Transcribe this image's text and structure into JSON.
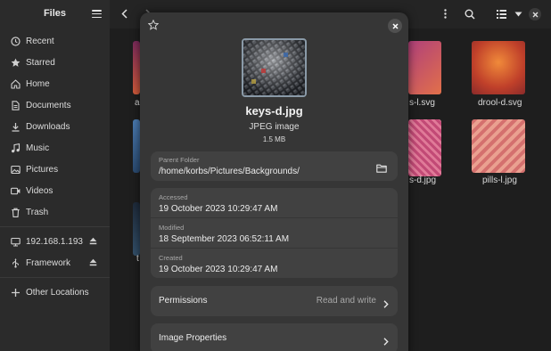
{
  "sidebar": {
    "title": "Files",
    "items": [
      {
        "label": "Recent",
        "icon": "clock-icon"
      },
      {
        "label": "Starred",
        "icon": "star-icon"
      },
      {
        "label": "Home",
        "icon": "home-icon"
      },
      {
        "label": "Documents",
        "icon": "document-icon"
      },
      {
        "label": "Downloads",
        "icon": "download-icon"
      },
      {
        "label": "Music",
        "icon": "music-icon"
      },
      {
        "label": "Pictures",
        "icon": "pictures-icon"
      },
      {
        "label": "Videos",
        "icon": "video-icon"
      },
      {
        "label": "Trash",
        "icon": "trash-icon"
      }
    ],
    "mounts": [
      {
        "label": "192.168.1.193",
        "icon": "network-drive-icon"
      },
      {
        "label": "Framework",
        "icon": "usb-drive-icon"
      }
    ],
    "other": {
      "label": "Other Locations",
      "icon": "plus-icon"
    }
  },
  "grid": {
    "files": [
      {
        "label": "a"
      },
      {
        "label": "s-l.svg"
      },
      {
        "label": "drool-d.svg"
      },
      {
        "label": "s-d.jpg"
      },
      {
        "label": "pills-l.jpg"
      },
      {
        "label": "t"
      }
    ]
  },
  "dialog": {
    "file_name": "keys-d.jpg",
    "file_type": "JPEG image",
    "file_size": "1.5 MB",
    "parent_folder_label": "Parent Folder",
    "parent_folder_value": "/home/korbs/Pictures/Backgrounds/",
    "accessed_label": "Accessed",
    "accessed_value": "19 October 2023 10:29:47 AM",
    "modified_label": "Modified",
    "modified_value": "18 September 2023 06:52:11 AM",
    "created_label": "Created",
    "created_value": "19 October 2023 10:29:47 AM",
    "permissions_label": "Permissions",
    "permissions_value": "Read and write",
    "image_properties_label": "Image Properties",
    "close_icon": "close-icon",
    "star_icon": "star-icon"
  },
  "colors": {
    "sidebar_bg": "#2b2b2b",
    "dialog_bg": "#363636",
    "card_bg": "#414141",
    "content_bg": "#1e1e1e"
  }
}
